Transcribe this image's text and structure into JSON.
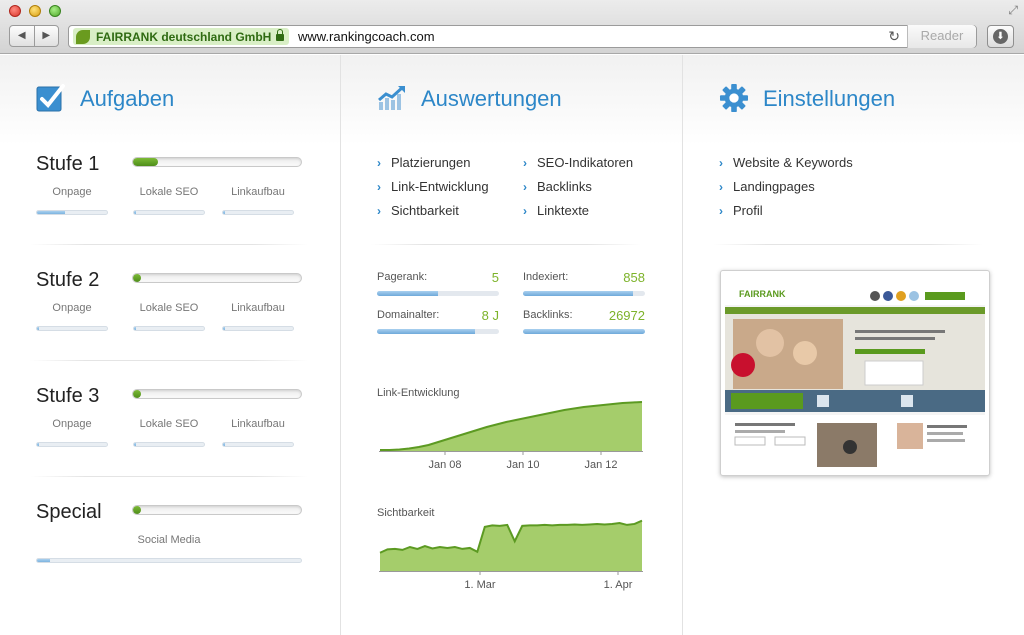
{
  "browser": {
    "site_name": "FAIRRANK deutschland GmbH",
    "url": "www.rankingcoach.com",
    "reader_label": "Reader"
  },
  "aufgaben": {
    "heading": "Aufgaben",
    "stufen": [
      {
        "title": "Stufe 1",
        "progress": 0.15,
        "subs": [
          {
            "label": "Onpage",
            "progress": 0.4
          },
          {
            "label": "Lokale SEO",
            "progress": 0.03
          },
          {
            "label": "Linkaufbau",
            "progress": 0.03
          }
        ]
      },
      {
        "title": "Stufe 2",
        "progress": 0.05,
        "subs": [
          {
            "label": "Onpage",
            "progress": 0.03
          },
          {
            "label": "Lokale SEO",
            "progress": 0.03
          },
          {
            "label": "Linkaufbau",
            "progress": 0.03
          }
        ]
      },
      {
        "title": "Stufe 3",
        "progress": 0.05,
        "subs": [
          {
            "label": "Onpage",
            "progress": 0.03
          },
          {
            "label": "Lokale SEO",
            "progress": 0.03
          },
          {
            "label": "Linkaufbau",
            "progress": 0.03
          }
        ]
      }
    ],
    "special": {
      "title": "Special",
      "progress": 0.05,
      "sub_label": "Social Media",
      "sub_progress": 0.05
    }
  },
  "auswertungen": {
    "heading": "Auswertungen",
    "links_left": [
      "Platzierungen",
      "Link-Entwicklung",
      "Sichtbarkeit"
    ],
    "links_right": [
      "SEO-Indikatoren",
      "Backlinks",
      "Linktexte"
    ],
    "metrics": [
      {
        "label": "Pagerank:",
        "value": "5",
        "progress": 0.5
      },
      {
        "label": "Indexiert:",
        "value": "858",
        "progress": 0.9
      },
      {
        "label": "Domainalter:",
        "value": "8 J",
        "progress": 0.8
      },
      {
        "label": "Backlinks:",
        "value": "26972",
        "progress": 1.0
      }
    ],
    "link_chart": {
      "title": "Link-Entwicklung",
      "ticks": [
        "Jan 08",
        "Jan 10",
        "Jan 12"
      ],
      "points": [
        0.02,
        0.02,
        0.03,
        0.05,
        0.08,
        0.12,
        0.18,
        0.24,
        0.3,
        0.36,
        0.42,
        0.48,
        0.53,
        0.58,
        0.62,
        0.66,
        0.7,
        0.74,
        0.78,
        0.82,
        0.85,
        0.88,
        0.9,
        0.92,
        0.94,
        0.96,
        0.97,
        0.98
      ]
    },
    "sicht_chart": {
      "title": "Sichtbarkeit",
      "ticks": [
        "1. Mar",
        "1. Apr"
      ],
      "points": [
        0.38,
        0.45,
        0.46,
        0.44,
        0.5,
        0.46,
        0.52,
        0.47,
        0.5,
        0.48,
        0.5,
        0.46,
        0.48,
        0.4,
        0.92,
        0.95,
        0.94,
        0.96,
        0.62,
        0.94,
        0.95,
        0.95,
        0.96,
        0.95,
        0.96,
        0.96,
        0.97,
        0.96,
        0.97,
        0.98,
        0.97,
        0.98,
        1.0,
        0.96,
        0.98,
        1.05
      ]
    }
  },
  "einstellungen": {
    "heading": "Einstellungen",
    "links": [
      "Website & Keywords",
      "Landingpages",
      "Profil"
    ],
    "preview_logo": "FAIRRANK"
  },
  "colors": {
    "accent": "#2d87c8",
    "green": "#5a9a1e",
    "chart_fill": "#a5cd6b",
    "chart_line": "#5c9a22"
  }
}
